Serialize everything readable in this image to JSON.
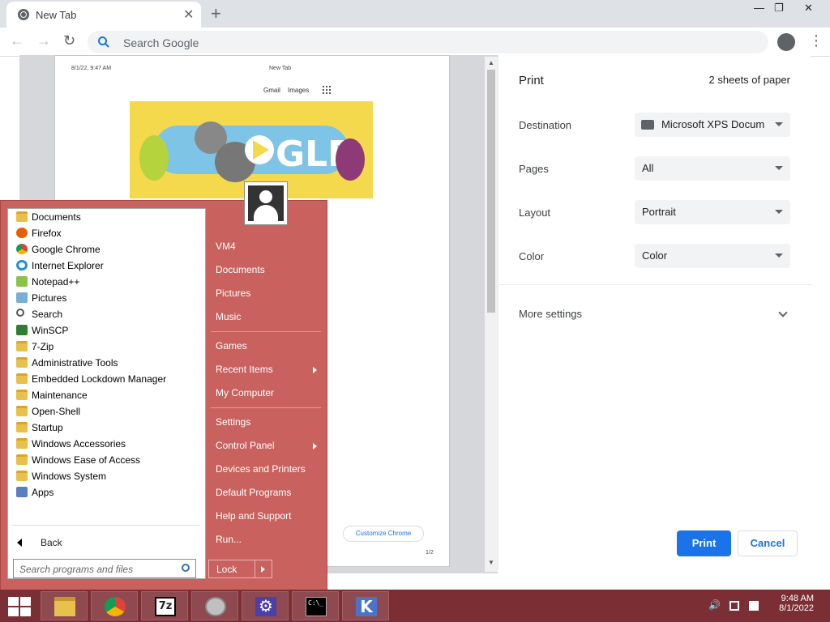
{
  "browser": {
    "tab_title": "New Tab",
    "tab_close": "✕",
    "new_tab": "+",
    "min": "—",
    "max": "❐",
    "close": "✕",
    "back": "←",
    "forward": "→",
    "reload": "↻",
    "omnibox_placeholder": "Search Google",
    "menu": "⋮"
  },
  "preview": {
    "header_left": "8/1/22, 9:47 AM",
    "header_center": "New Tab",
    "gmail": "Gmail",
    "images": "Images",
    "customize": "Customize Chrome",
    "page_number": "1/2"
  },
  "print_panel": {
    "title": "Print",
    "sheets": "2 sheets of paper",
    "destination_label": "Destination",
    "destination_value": "Microsoft XPS Docum",
    "pages_label": "Pages",
    "pages_value": "All",
    "layout_label": "Layout",
    "layout_value": "Portrait",
    "color_label": "Color",
    "color_value": "Color",
    "more_settings": "More settings",
    "print_button": "Print",
    "cancel_button": "Cancel"
  },
  "start_menu": {
    "programs": [
      {
        "label": "Documents",
        "icon": "documents-folder-icon"
      },
      {
        "label": "Firefox",
        "icon": "firefox-icon"
      },
      {
        "label": "Google Chrome",
        "icon": "chrome-icon"
      },
      {
        "label": "Internet Explorer",
        "icon": "ie-icon"
      },
      {
        "label": "Notepad++",
        "icon": "notepadpp-icon"
      },
      {
        "label": "Pictures",
        "icon": "pictures-folder-icon"
      },
      {
        "label": "Search",
        "icon": "search-icon"
      },
      {
        "label": "WinSCP",
        "icon": "winscp-icon"
      },
      {
        "label": "7-Zip",
        "icon": "folder-icon"
      },
      {
        "label": "Administrative Tools",
        "icon": "folder-icon"
      },
      {
        "label": "Embedded Lockdown Manager",
        "icon": "folder-icon"
      },
      {
        "label": "Maintenance",
        "icon": "folder-icon"
      },
      {
        "label": "Open-Shell",
        "icon": "folder-icon"
      },
      {
        "label": "Startup",
        "icon": "folder-icon"
      },
      {
        "label": "Windows Accessories",
        "icon": "folder-icon"
      },
      {
        "label": "Windows Ease of Access",
        "icon": "folder-icon"
      },
      {
        "label": "Windows System",
        "icon": "folder-icon"
      },
      {
        "label": "Apps",
        "icon": "apps-icon"
      }
    ],
    "back": "Back",
    "search_placeholder": "Search programs and files",
    "right_items": {
      "vm4": "VM4",
      "documents": "Documents",
      "pictures": "Pictures",
      "music": "Music",
      "games": "Games",
      "recent_items": "Recent Items",
      "my_computer": "My Computer",
      "settings": "Settings",
      "control_panel": "Control Panel",
      "devices_printers": "Devices and Printers",
      "default_programs": "Default Programs",
      "help_support": "Help and Support",
      "run": "Run..."
    },
    "lock": "Lock"
  },
  "taskbar": {
    "time": "9:48 AM",
    "date": "8/1/2022",
    "sevenzip": "7z",
    "cmd": "C:\\_"
  },
  "colors": {
    "accent": "#1a73e8",
    "start_menu": "#c9625f",
    "taskbar": "#7b2f35"
  }
}
